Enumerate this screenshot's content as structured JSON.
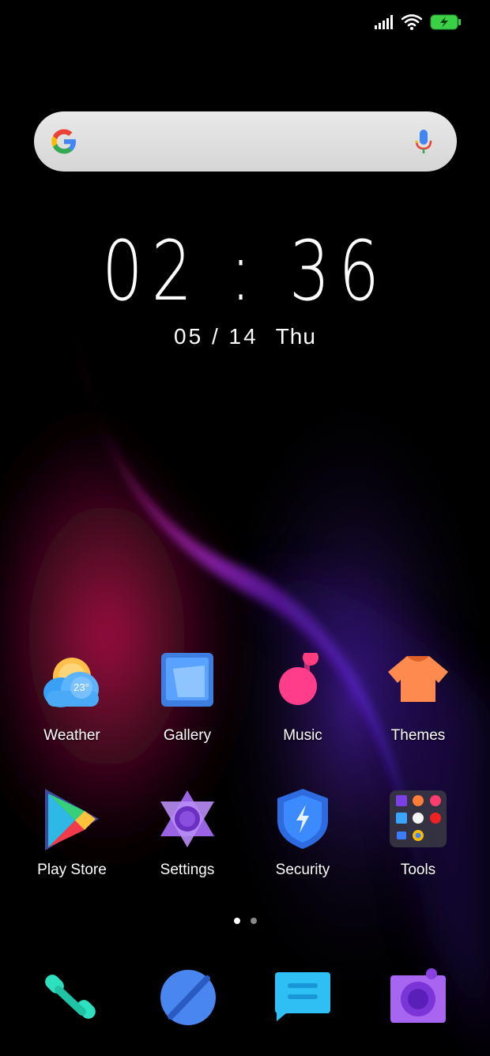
{
  "status": {
    "signal_icon": "cellular-signal-icon",
    "wifi_icon": "wifi-icon",
    "battery_icon": "battery-charging-icon",
    "battery_color": "#3bd147"
  },
  "search": {
    "logo_icon": "google-g-icon",
    "mic_icon": "microphone-icon"
  },
  "clock": {
    "time": "02 : 36",
    "date": "05 / 14",
    "weekday": "Thu"
  },
  "apps": [
    {
      "label": "Weather",
      "icon": "weather-icon",
      "temp": "23°"
    },
    {
      "label": "Gallery",
      "icon": "gallery-icon"
    },
    {
      "label": "Music",
      "icon": "music-icon"
    },
    {
      "label": "Themes",
      "icon": "themes-tshirt-icon"
    },
    {
      "label": "Play Store",
      "icon": "play-store-icon"
    },
    {
      "label": "Settings",
      "icon": "settings-icon"
    },
    {
      "label": "Security",
      "icon": "security-shield-icon"
    },
    {
      "label": "Tools",
      "icon": "tools-folder-icon"
    }
  ],
  "pager": {
    "pages": 2,
    "current": 1
  },
  "dock": [
    {
      "icon": "phone-icon"
    },
    {
      "icon": "browser-icon"
    },
    {
      "icon": "messages-icon"
    },
    {
      "icon": "camera-icon"
    }
  ]
}
